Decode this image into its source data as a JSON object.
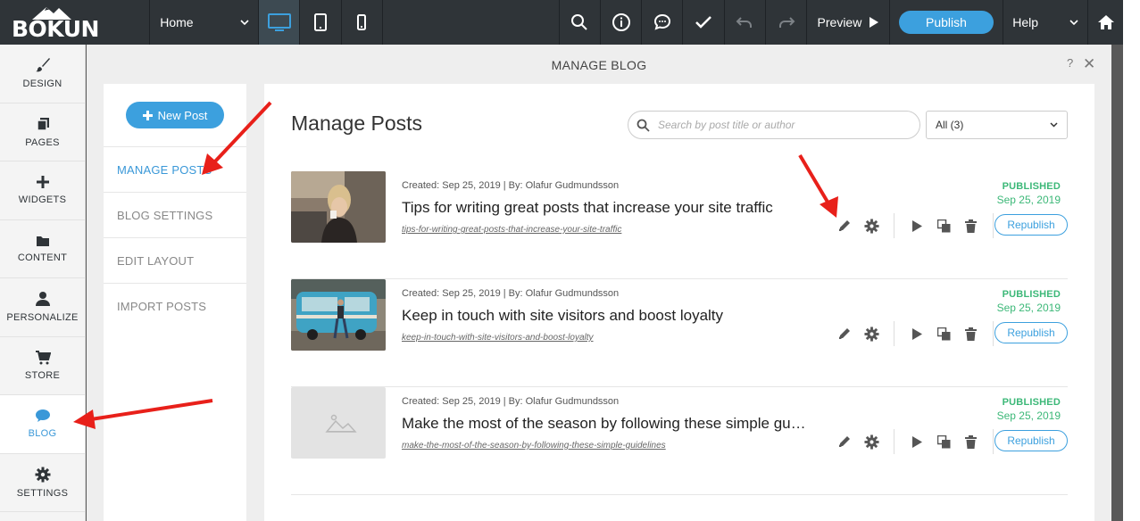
{
  "topbar": {
    "logo": "BÓKUN",
    "page_select": "Home",
    "preview": "Preview",
    "publish": "Publish",
    "help": "Help"
  },
  "leftnav": [
    {
      "label": "DESIGN",
      "icon": "brush-icon"
    },
    {
      "label": "PAGES",
      "icon": "pages-icon"
    },
    {
      "label": "WIDGETS",
      "icon": "plus-icon"
    },
    {
      "label": "CONTENT",
      "icon": "folder-icon"
    },
    {
      "label": "PERSONALIZE",
      "icon": "user-icon"
    },
    {
      "label": "STORE",
      "icon": "cart-icon"
    },
    {
      "label": "BLOG",
      "icon": "chat-icon",
      "active": true
    },
    {
      "label": "SETTINGS",
      "icon": "gear-icon"
    }
  ],
  "modal": {
    "title": "MANAGE BLOG",
    "help": "?",
    "close": "✕"
  },
  "sidemenu": {
    "new_post": "New Post",
    "items": [
      "MANAGE POSTS",
      "BLOG SETTINGS",
      "EDIT LAYOUT",
      "IMPORT POSTS"
    ]
  },
  "content": {
    "title": "Manage Posts",
    "search_placeholder": "Search by post title or author",
    "filter": "All (3)",
    "republish": "Republish",
    "posts": [
      {
        "meta": "Created: Sep 25, 2019 | By: Olafur Gudmundsson",
        "title": "Tips for writing great posts that increase your site traffic",
        "slug": "tips-for-writing-great-posts-that-increase-your-site-traffic",
        "status": "PUBLISHED",
        "date": "Sep 25, 2019"
      },
      {
        "meta": "Created: Sep 25, 2019 | By: Olafur Gudmundsson",
        "title": "Keep in touch with site visitors and boost loyalty",
        "slug": "keep-in-touch-with-site-visitors-and-boost-loyalty",
        "status": "PUBLISHED",
        "date": "Sep 25, 2019"
      },
      {
        "meta": "Created: Sep 25, 2019 | By: Olafur Gudmundsson",
        "title": "Make the most of the season by following these simple gu…",
        "slug": "make-the-most-of-the-season-by-following-these-simple-guidelines",
        "status": "PUBLISHED",
        "date": "Sep 25, 2019"
      }
    ]
  },
  "colors": {
    "accent": "#3ca0de",
    "published": "#3cb878",
    "topbar": "#2f3438",
    "annotation_arrow": "#e8201a"
  }
}
